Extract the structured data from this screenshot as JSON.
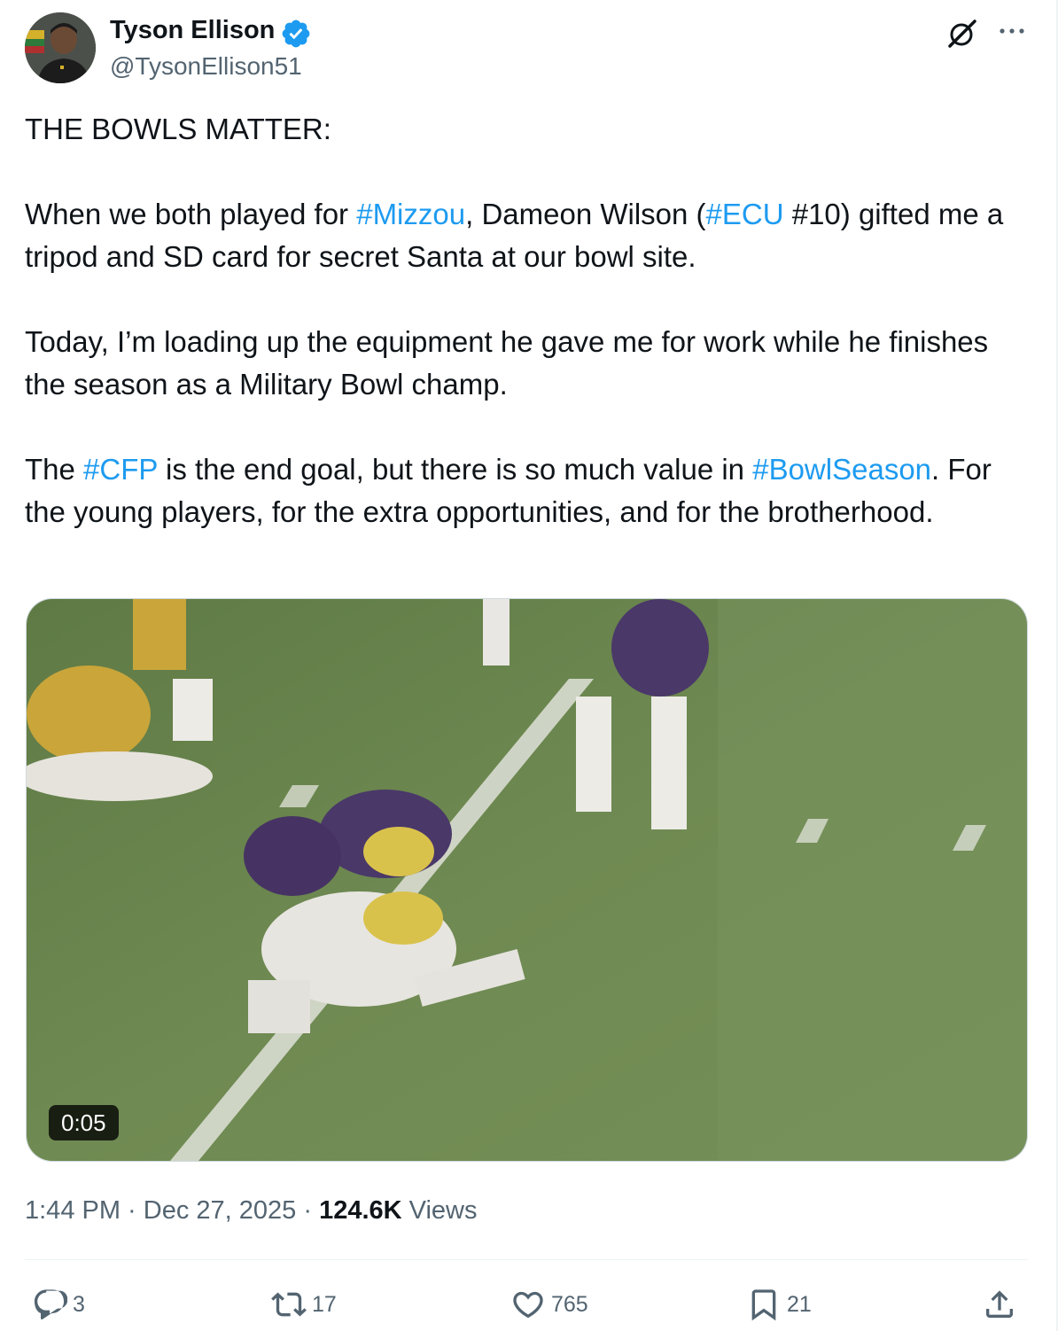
{
  "author": {
    "name": "Tyson Ellison",
    "handle": "@TysonEllison51",
    "verified": true
  },
  "icons": {
    "verified": "verified-badge-icon",
    "grok": "grok-icon",
    "more": "more-options-icon"
  },
  "tweet": {
    "p1": "THE BOWLS MATTER:",
    "p2": {
      "t1": "When we both played for ",
      "tag1": "#Mizzou",
      "t2": ", Dameon Wilson (",
      "tag2": "#ECU",
      "t3": " #10) gifted me a tripod and SD card for secret Santa at our bowl site."
    },
    "p3": "Today, I’m loading up the equipment he gave me for work while he finishes the season as a Military Bowl champ.",
    "p4": {
      "t1": "The ",
      "tag1": "#CFP",
      "t2": " is the end goal, but there is so much value in ",
      "tag2": "#BowlSeason",
      "t3": ". For the young players, for the extra opportunities, and for the brotherhood."
    }
  },
  "media": {
    "type": "video",
    "duration": "0:05"
  },
  "meta": {
    "time": "1:44 PM",
    "sep1": " · ",
    "date": "Dec 27, 2025",
    "sep2": " · ",
    "views_count": "124.6K",
    "views_label": " Views"
  },
  "actions": {
    "replies": "3",
    "reposts": "17",
    "likes": "765",
    "bookmarks": "21"
  },
  "colors": {
    "link": "#1d9bf0",
    "secondary_text": "#536471",
    "divider": "#eff3f4"
  }
}
